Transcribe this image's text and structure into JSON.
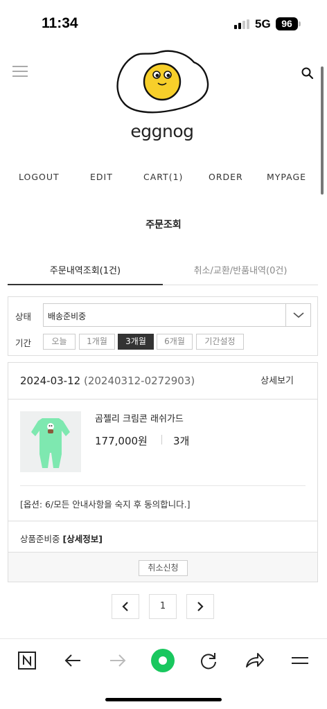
{
  "status_bar": {
    "time": "11:34",
    "network": "5G",
    "battery": "96"
  },
  "header": {
    "logo_text": "eggnog",
    "nav": [
      "LOGOUT",
      "EDIT",
      "CART(1)",
      "ORDER",
      "MYPAGE"
    ]
  },
  "page": {
    "title": "주문조회"
  },
  "tabs": [
    {
      "label": "주문내역조회(1건)",
      "active": true
    },
    {
      "label": "취소/교환/반품내역(0건)",
      "active": false
    }
  ],
  "filter": {
    "status_label": "상태",
    "status_value": "배송준비중",
    "period_label": "기간",
    "period_options": [
      "오늘",
      "1개월",
      "3개월",
      "6개월",
      "기간설정"
    ],
    "period_selected": "3개월"
  },
  "order": {
    "date": "2024-03-12",
    "order_number": "(20240312-0272903)",
    "detail_link": "상세보기",
    "product_name": "곰젤리 크림콘 래쉬가드",
    "price": "177,000원",
    "quantity": "3개",
    "option": "[옵션: 6/모든 안내사항을 숙지 후 동의합니다.]",
    "status": "상품준비중",
    "status_detail": "[상세정보]",
    "cancel_button": "취소신청"
  },
  "pagination": {
    "current_page": "1"
  },
  "colors": {
    "accent_green": "#19c75e",
    "product_green": "#7ee8b0",
    "egg_yolk": "#f7cf2a",
    "dark": "#333333"
  },
  "browser_toolbar": {
    "icons": [
      "naver-icon",
      "back-arrow-icon",
      "forward-arrow-icon",
      "green-home-icon",
      "reload-icon",
      "share-icon",
      "menu-icon"
    ]
  }
}
